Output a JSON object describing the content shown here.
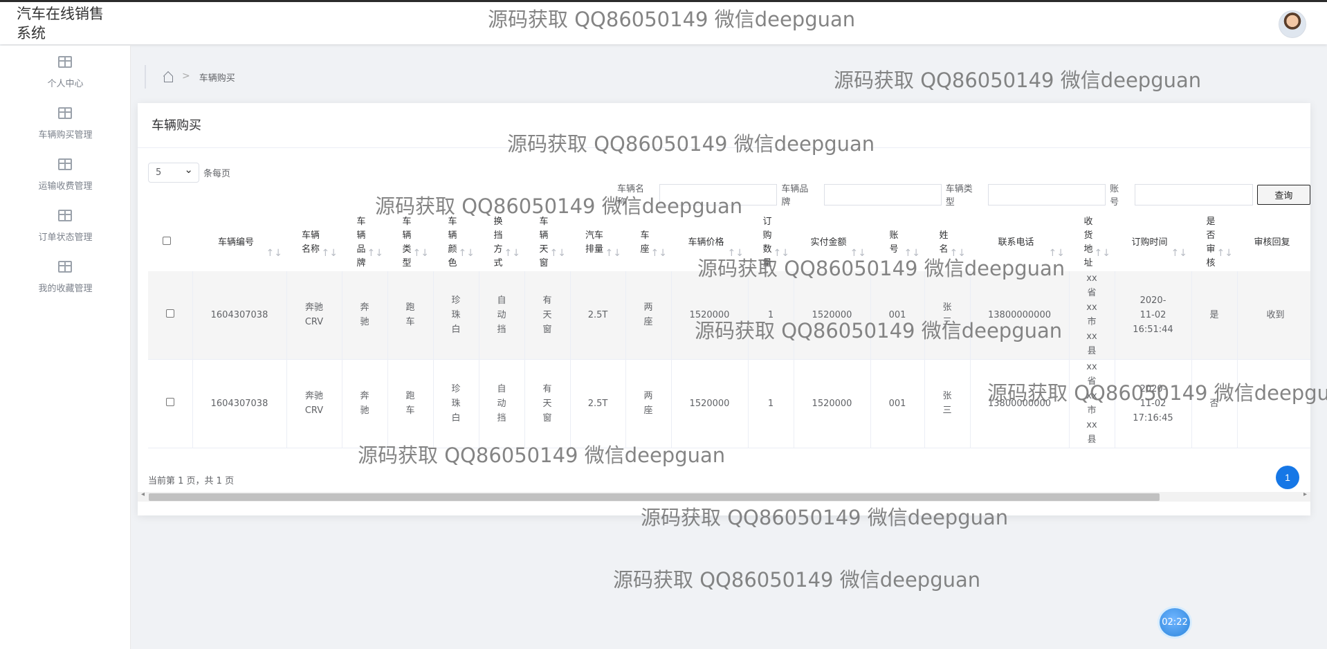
{
  "app": {
    "title": "汽车在线销售\n系统"
  },
  "sidebar": {
    "items": [
      {
        "label": "个人中心",
        "icon": "table-icon"
      },
      {
        "label": "车辆购买管理",
        "icon": "table-icon"
      },
      {
        "label": "运输收费管理",
        "icon": "table-icon"
      },
      {
        "label": "订单状态管理",
        "icon": "table-icon"
      },
      {
        "label": "我的收藏管理",
        "icon": "table-icon"
      }
    ]
  },
  "breadcrumb": {
    "separator": ">",
    "current": "车辆购买"
  },
  "main": {
    "title": "车辆购买",
    "page_size": "5",
    "page_size_suffix": "条每页",
    "filters": [
      {
        "label": "车辆名称",
        "value": ""
      },
      {
        "label": "车辆品牌",
        "value": ""
      },
      {
        "label": "车辆类型",
        "value": ""
      },
      {
        "label": "账号",
        "value": ""
      }
    ],
    "search_button": "查询",
    "columns": [
      "车辆编号",
      "车辆\n名称",
      "车\n辆\n品\n牌",
      "车\n辆\n类\n型",
      "车\n辆\n颜\n色",
      "换\n挡\n方\n式",
      "车\n辆\n天\n窗",
      "汽车\n排量",
      "车\n座",
      "车辆价格",
      "订\n购\n数\n量",
      "实付金额",
      "账\n号",
      "姓\n名",
      "联系电话",
      "收\n货\n地\n址",
      "订购时间",
      "是\n否\n审\n核",
      "审核回复"
    ],
    "rows": [
      [
        "1604307038",
        "奔驰\nCRV",
        "奔\n驰",
        "跑\n车",
        "珍\n珠\n白",
        "自\n动\n挡",
        "有\n天\n窗",
        "2.5T",
        "两\n座",
        "1520000",
        "1",
        "1520000",
        "001",
        "张\n三",
        "13800000000",
        "xx\n省\nxx\n市\nxx\n县",
        "2020-\n11-02\n16:51:44",
        "是",
        "收到"
      ],
      [
        "1604307038",
        "奔驰\nCRV",
        "奔\n驰",
        "跑\n车",
        "珍\n珠\n白",
        "自\n动\n挡",
        "有\n天\n窗",
        "2.5T",
        "两\n座",
        "1520000",
        "1",
        "1520000",
        "001",
        "张\n三",
        "13800000000",
        "xx\n省\nxx\n市\nxx\n县",
        "2020-\n11-02\n17:16:45",
        "否",
        ""
      ]
    ],
    "sort_icon": "↑↓",
    "pager_text": "当前第 1 页，共 1 页",
    "current_page": "1",
    "scroll_left": "◂",
    "scroll_right": "▸"
  },
  "watermarks": [
    "源码获取 QQ86050149 微信deepguan",
    "源码获取 QQ86050149 微信deepguan",
    "源码获取 QQ86050149 微信deepguan",
    "源码获取 QQ86050149 微信deepguan",
    "源码获取 QQ86050149 微信deepguan",
    "源码获取 QQ86050149 微信deepguan",
    "源码获取 QQ86050149 微信deepgu",
    "源码获取 QQ86050149 微信deepguan",
    "源码获取 QQ86050149 微信deepguan",
    "源码获取 QQ86050149 微信deepguan"
  ],
  "timer": "02:22",
  "colors": {
    "accent": "#1677e6",
    "background": "#f0f2f5",
    "text": "#606266"
  }
}
